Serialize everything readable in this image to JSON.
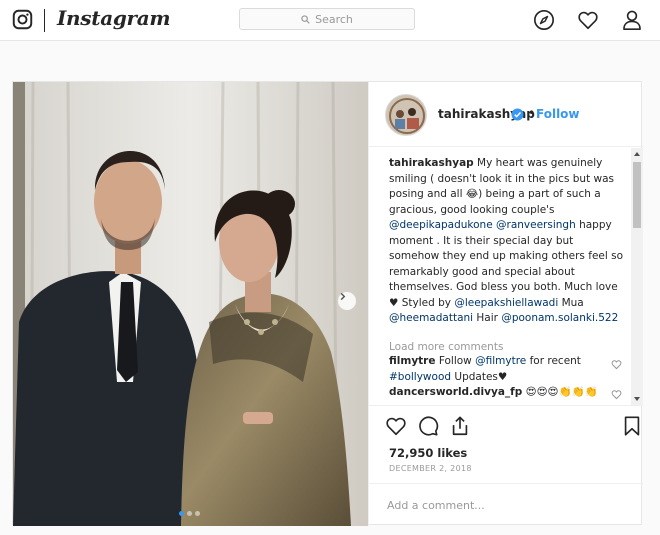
{
  "nav": {
    "logo_text": "Instagram",
    "search_placeholder": "Search",
    "icons": [
      "camera-logo-icon",
      "explore-compass-icon",
      "activity-heart-icon",
      "profile-person-icon"
    ]
  },
  "post": {
    "username": "tahirakashyap",
    "verified": true,
    "separator": "•",
    "follow_label": "Follow",
    "caption_segments": [
      {
        "type": "user",
        "text": "tahirakashyap"
      },
      {
        "type": "text",
        "text": " My heart was genuinely smiling ( doesn't look it in the pics but was posing and all 😂) being a part of such a gracious, good looking couple's "
      },
      {
        "type": "mention",
        "text": "@deepikapadukone"
      },
      {
        "type": "text",
        "text": " "
      },
      {
        "type": "mention",
        "text": "@ranveersingh"
      },
      {
        "type": "text",
        "text": " happy moment . It is their special day but somehow they end up making others feel so remarkably good and special about themselves. God bless you both. Much love ♥ Styled by "
      },
      {
        "type": "mention",
        "text": "@leepakshiellawadi"
      },
      {
        "type": "text",
        "text": " Mua "
      },
      {
        "type": "mention",
        "text": "@heemadattani"
      },
      {
        "type": "text",
        "text": " Hair "
      },
      {
        "type": "mention",
        "text": "@poonam.solanki.522"
      }
    ],
    "load_more_label": "Load more comments",
    "comments": [
      {
        "segments": [
          {
            "type": "user",
            "text": "filmytre"
          },
          {
            "type": "text",
            "text": " Follow "
          },
          {
            "type": "mention",
            "text": "@filmytre"
          },
          {
            "type": "text",
            "text": " for recent "
          },
          {
            "type": "mention",
            "text": "#bollywood"
          },
          {
            "type": "text",
            "text": " Updates♥"
          }
        ]
      },
      {
        "segments": [
          {
            "type": "user",
            "text": "dancersworld.divya_fp"
          },
          {
            "type": "text",
            "text": " 😍😍😍👏👏👏"
          }
        ]
      }
    ],
    "likes_text": "72,950 likes",
    "date_text": "DECEMBER 2, 2018",
    "add_comment_placeholder": "Add a comment...",
    "carousel": {
      "slides": 3,
      "active_index": 0
    },
    "action_icons": [
      "like-heart-icon",
      "comment-bubble-icon",
      "share-icon",
      "bookmark-icon"
    ]
  },
  "colors": {
    "link_blue": "#3897f0",
    "mention_blue": "#003569",
    "muted_gray": "#999999",
    "text": "#262626",
    "border": "#e6e6e6"
  }
}
